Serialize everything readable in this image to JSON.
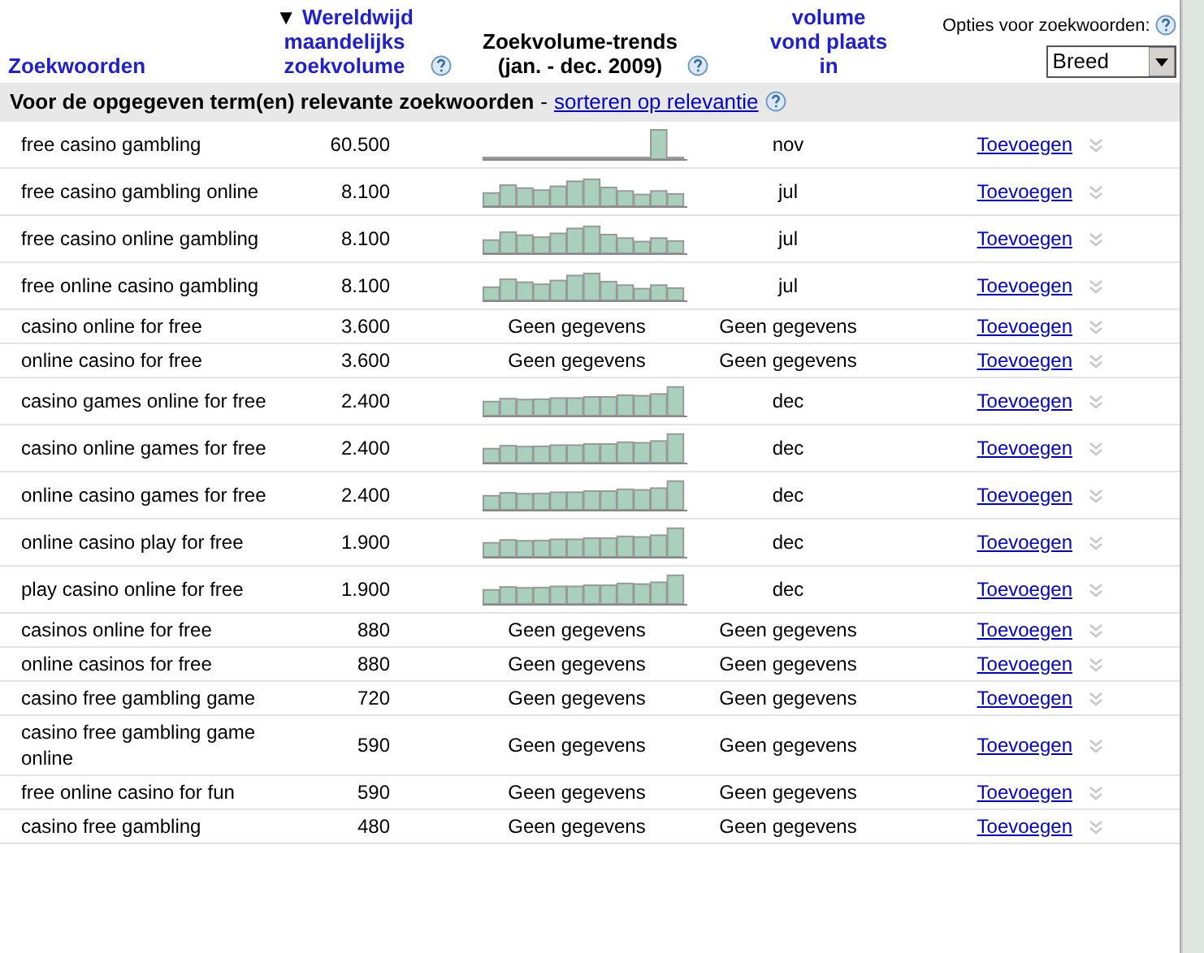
{
  "header": {
    "keyword_column": "Zoekwoorden",
    "volume_column": {
      "sort_arrow": "▼",
      "label": "Wereldwijd maandelijks zoekvolume"
    },
    "trend_column": "Zoekvolume-trends (jan. - dec. 2009)",
    "peak_column": "volume vond plaats in",
    "options": {
      "label": "Opties voor zoekwoorden:",
      "match_type": "Breed"
    }
  },
  "section": {
    "title": "Voor de opgegeven term(en) relevante zoekwoorden",
    "separator": "-",
    "sort_link": "sorteren op relevantie"
  },
  "rows": [
    {
      "keyword": "free casino gambling",
      "volume": "60.500",
      "kind": "spike",
      "peak": "nov",
      "action": "Toevoegen"
    },
    {
      "keyword": "free casino gambling online",
      "volume": "8.100",
      "kind": "wave",
      "peak": "jul",
      "action": "Toevoegen"
    },
    {
      "keyword": "free casino online gambling",
      "volume": "8.100",
      "kind": "wave",
      "peak": "jul",
      "action": "Toevoegen"
    },
    {
      "keyword": "free online casino gambling",
      "volume": "8.100",
      "kind": "wave",
      "peak": "jul",
      "action": "Toevoegen"
    },
    {
      "keyword": "casino online for free",
      "volume": "3.600",
      "no_data": "Geen gegevens",
      "peak": "Geen gegevens",
      "action": "Toevoegen"
    },
    {
      "keyword": "online casino for free",
      "volume": "3.600",
      "no_data": "Geen gegevens",
      "peak": "Geen gegevens",
      "action": "Toevoegen"
    },
    {
      "keyword": "casino games online for free",
      "volume": "2.400",
      "kind": "rising",
      "peak": "dec",
      "action": "Toevoegen"
    },
    {
      "keyword": "casino online games for free",
      "volume": "2.400",
      "kind": "rising",
      "peak": "dec",
      "action": "Toevoegen"
    },
    {
      "keyword": "online casino games for free",
      "volume": "2.400",
      "kind": "rising",
      "peak": "dec",
      "action": "Toevoegen"
    },
    {
      "keyword": "online casino play for free",
      "volume": "1.900",
      "kind": "rising",
      "peak": "dec",
      "action": "Toevoegen"
    },
    {
      "keyword": "play casino online for free",
      "volume": "1.900",
      "kind": "rising",
      "peak": "dec",
      "action": "Toevoegen"
    },
    {
      "keyword": "casinos online for free",
      "volume": "880",
      "no_data": "Geen gegevens",
      "peak": "Geen gegevens",
      "action": "Toevoegen"
    },
    {
      "keyword": "online casinos for free",
      "volume": "880",
      "no_data": "Geen gegevens",
      "peak": "Geen gegevens",
      "action": "Toevoegen"
    },
    {
      "keyword": "casino free gambling game",
      "volume": "720",
      "no_data": "Geen gegevens",
      "peak": "Geen gegevens",
      "action": "Toevoegen"
    },
    {
      "keyword": "casino free gambling game online",
      "volume": "590",
      "no_data": "Geen gegevens",
      "peak": "Geen gegevens",
      "action": "Toevoegen"
    },
    {
      "keyword": "free online casino for fun",
      "volume": "590",
      "no_data": "Geen gegevens",
      "peak": "Geen gegevens",
      "action": "Toevoegen"
    },
    {
      "keyword": "casino free gambling",
      "volume": "480",
      "no_data": "Geen gegevens",
      "peak": "Geen gegevens",
      "action": "Toevoegen"
    }
  ]
}
